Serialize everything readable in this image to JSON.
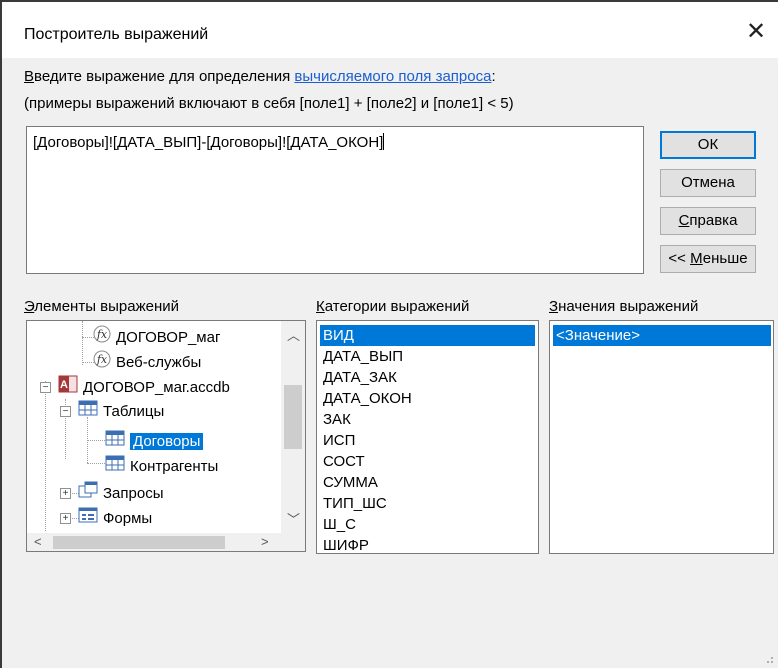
{
  "window": {
    "title": "Построитель выражений"
  },
  "instructions": {
    "line1_prefix": "Введите выражение для определения ",
    "line1_link": "вычисляемого поля запроса",
    "line1_suffix": ":",
    "line2": "(примеры выражений включают в себя [поле1] + [поле2] и [поле1] < 5)"
  },
  "expression": {
    "value": "[Договоры]![ДАТА_ВЫП]-[Договоры]![ДАТА_ОКОН]"
  },
  "buttons": {
    "ok": "ОК",
    "cancel": "Отмена",
    "help_accel": "С",
    "help_rest": "правка",
    "less_prefix": "<< ",
    "less_accel": "М",
    "less_rest": "еньше"
  },
  "panels": {
    "elements": {
      "accel": "Э",
      "rest": "лементы выражений"
    },
    "categories": {
      "accel": "К",
      "rest": "атегории выражений"
    },
    "values": {
      "accel": "З",
      "rest": "начения выражений"
    }
  },
  "tree": {
    "items": [
      {
        "label": "ДОГОВОР_маг",
        "icon": "function-icon"
      },
      {
        "label": "Веб-службы",
        "icon": "function-icon"
      },
      {
        "label": "ДОГОВОР_маг.accdb",
        "icon": "access-db-icon"
      },
      {
        "label": "Таблицы",
        "icon": "tables-folder-icon"
      },
      {
        "label": "Договоры",
        "icon": "table-icon",
        "selected": true
      },
      {
        "label": "Контрагенты",
        "icon": "table-icon"
      },
      {
        "label": "Запросы",
        "icon": "queries-folder-icon"
      },
      {
        "label": "Формы",
        "icon": "forms-folder-icon"
      }
    ]
  },
  "categories": {
    "items": [
      "ВИД",
      "ДАТА_ВЫП",
      "ДАТА_ЗАК",
      "ДАТА_ОКОН",
      "ЗАК",
      "ИСП",
      "СОСТ",
      "СУММА",
      "ТИП_ШС",
      "Ш_С",
      "ШИФР"
    ],
    "selected_index": 0
  },
  "values": {
    "items": [
      "<Значение>"
    ],
    "selected_index": 0
  },
  "colors": {
    "accent": "#0078d7",
    "link": "#1a5fd1",
    "dialog_bg": "#f0f0f0"
  }
}
